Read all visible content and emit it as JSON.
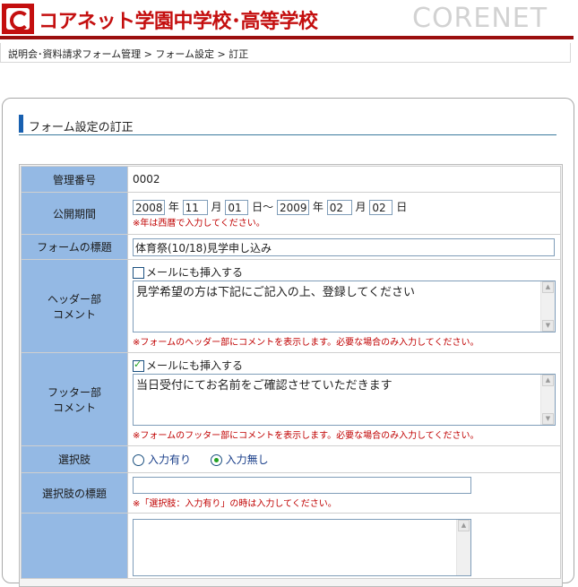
{
  "header": {
    "school_name": "コアネット学園中学校･高等学校",
    "brand": "CORENET"
  },
  "breadcrumb": "説明会･資料請求フォーム管理 > フォーム設定 > 訂正",
  "section_title": "フォーム設定の訂正",
  "form": {
    "mgmt_no": {
      "label": "管理番号",
      "value": "0002"
    },
    "period": {
      "label": "公開期間",
      "start_year": "2008",
      "start_month": "11",
      "start_day": "01",
      "end_year": "2009",
      "end_month": "02",
      "end_day": "02",
      "u_year": "年",
      "u_month": "月",
      "u_day_tilde": "日～",
      "u_day": "日",
      "note": "※年は西暦で入力してください。"
    },
    "form_title": {
      "label": "フォームの標題",
      "value": "体育祭(10/18)見学申し込み"
    },
    "header_comment": {
      "label_1": "ヘッダー部",
      "label_2": "コメント",
      "checkbox_label": "メールにも挿入する",
      "checked": false,
      "value": "見学希望の方は下記にご記入の上、登録してください",
      "note": "※フォームのヘッダー部にコメントを表示します。必要な場合のみ入力してください。"
    },
    "footer_comment": {
      "label_1": "フッター部",
      "label_2": "コメント",
      "checkbox_label": "メールにも挿入する",
      "checked": true,
      "value": "当日受付にてお名前をご確認させていただきます",
      "note": "※フォームのフッター部にコメントを表示します。必要な場合のみ入力してください。"
    },
    "choice": {
      "label": "選択肢",
      "option_yes": "入力有り",
      "option_no": "入力無し",
      "selected": "入力無し"
    },
    "choice_title": {
      "label": "選択肢の標題",
      "value": "",
      "note": "※「選択肢：入力有り」の時は入力してください。"
    }
  }
}
